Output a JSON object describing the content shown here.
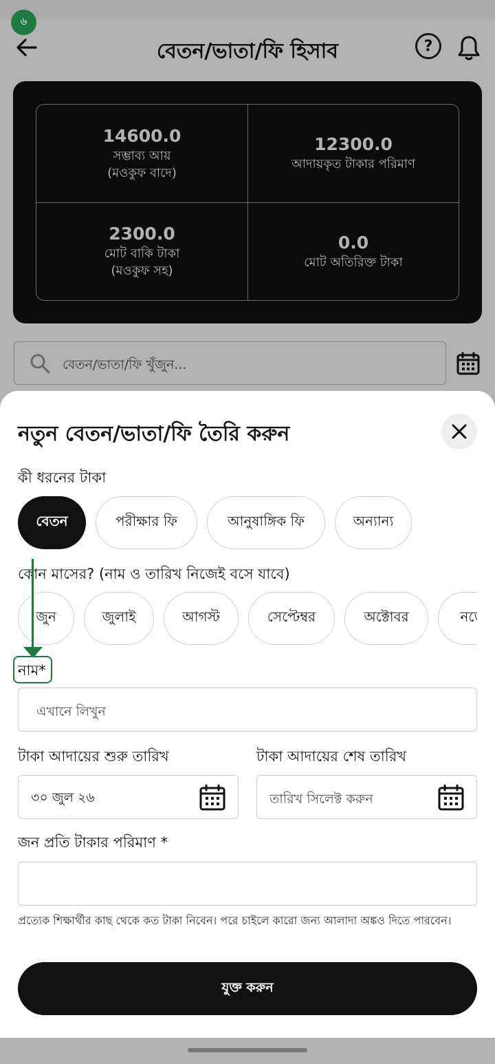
{
  "status": {
    "badge": "৬"
  },
  "header": {
    "title": "বেতন/ভাতা/ফি হিসাব",
    "help": "?"
  },
  "summary": {
    "cells": [
      {
        "value": "14600.0",
        "label1": "সম্ভাব্য আয়",
        "label2": "(মওকুফ বাদে)"
      },
      {
        "value": "12300.0",
        "label1": "আদায়কৃত টাকার পরিমাণ",
        "label2": ""
      },
      {
        "value": "2300.0",
        "label1": "মোট বাকি টাকা",
        "label2": "(মওকুফ সহ)"
      },
      {
        "value": "0.0",
        "label1": "মোট অতিরিক্ত টাকা",
        "label2": ""
      }
    ]
  },
  "search": {
    "placeholder": "বেতন/ভাতা/ফি খুঁজুন..."
  },
  "sheet": {
    "title": "নতুন বেতন/ভাতা/ফি তৈরি করুন",
    "type_label": "কী ধরনের টাকা",
    "types": [
      "বেতন",
      "পরীক্ষার ফি",
      "আনুষাঙ্গিক ফি",
      "অন্যান্য"
    ],
    "selected_type": "বেতন",
    "month_label": "কোন মাসের? (নাম ও তারিখ নিজেই বসে যাবে)",
    "months": [
      "জুন",
      "জুলাই",
      "আগস্ট",
      "সেপ্টেম্বর",
      "অক্টোবর",
      "নভে"
    ],
    "name_label": "নাম*",
    "name_placeholder": "এখানে লিখুন",
    "start_label": "টাকা আদায়ের শুরু তারিখ",
    "start_value": "৩০ জুল ২৬",
    "end_label": "টাকা আদায়ের শেষ তারিখ",
    "end_placeholder": "তারিখ সিলেক্ট করুন",
    "amount_label": "জন প্রতি টাকার পরিমাণ *",
    "amount_value": "",
    "helper": "প্রত্যেক শিক্ষার্থীর কাছ থেকে কত টাকা নিবেন। পরে চাইলে কারো জন্য আলাদা অঙ্কও দিতে পারবেন।",
    "submit": "যুক্ত করুন"
  },
  "colors": {
    "accent": "#1f7a3f",
    "dark": "#111111",
    "overlay": "rgba(0,0,0,0.30)"
  }
}
